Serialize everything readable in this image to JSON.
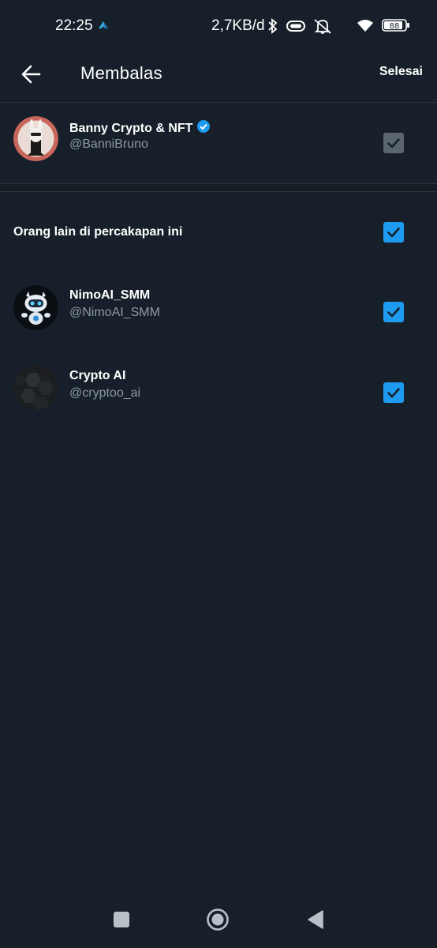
{
  "status_bar": {
    "time": "22:25",
    "speed": "2,7KB/d",
    "battery": "88",
    "icons": [
      "app-notification-icon",
      "bluetooth-icon",
      "vibrate-icon",
      "mute-icon",
      "wifi-icon",
      "battery-icon"
    ]
  },
  "header": {
    "title": "Membalas",
    "done_label": "Selesai"
  },
  "primary_user": {
    "name": "Banny Crypto & NFT",
    "handle": "@BanniBruno",
    "verified": true,
    "checked": true,
    "disabled": true
  },
  "others": {
    "label": "Orang lain di percakapan ini",
    "checked": true
  },
  "users": [
    {
      "name": "NimoAI_SMM",
      "handle": "@NimoAI_SMM",
      "checked": true
    },
    {
      "name": "Crypto AI",
      "handle": "@cryptoo_ai",
      "checked": true
    }
  ],
  "colors": {
    "background": "#17202a",
    "accent": "#1d9bf0",
    "secondary_text": "#8b98a5",
    "disabled_check": "#5b6570"
  }
}
